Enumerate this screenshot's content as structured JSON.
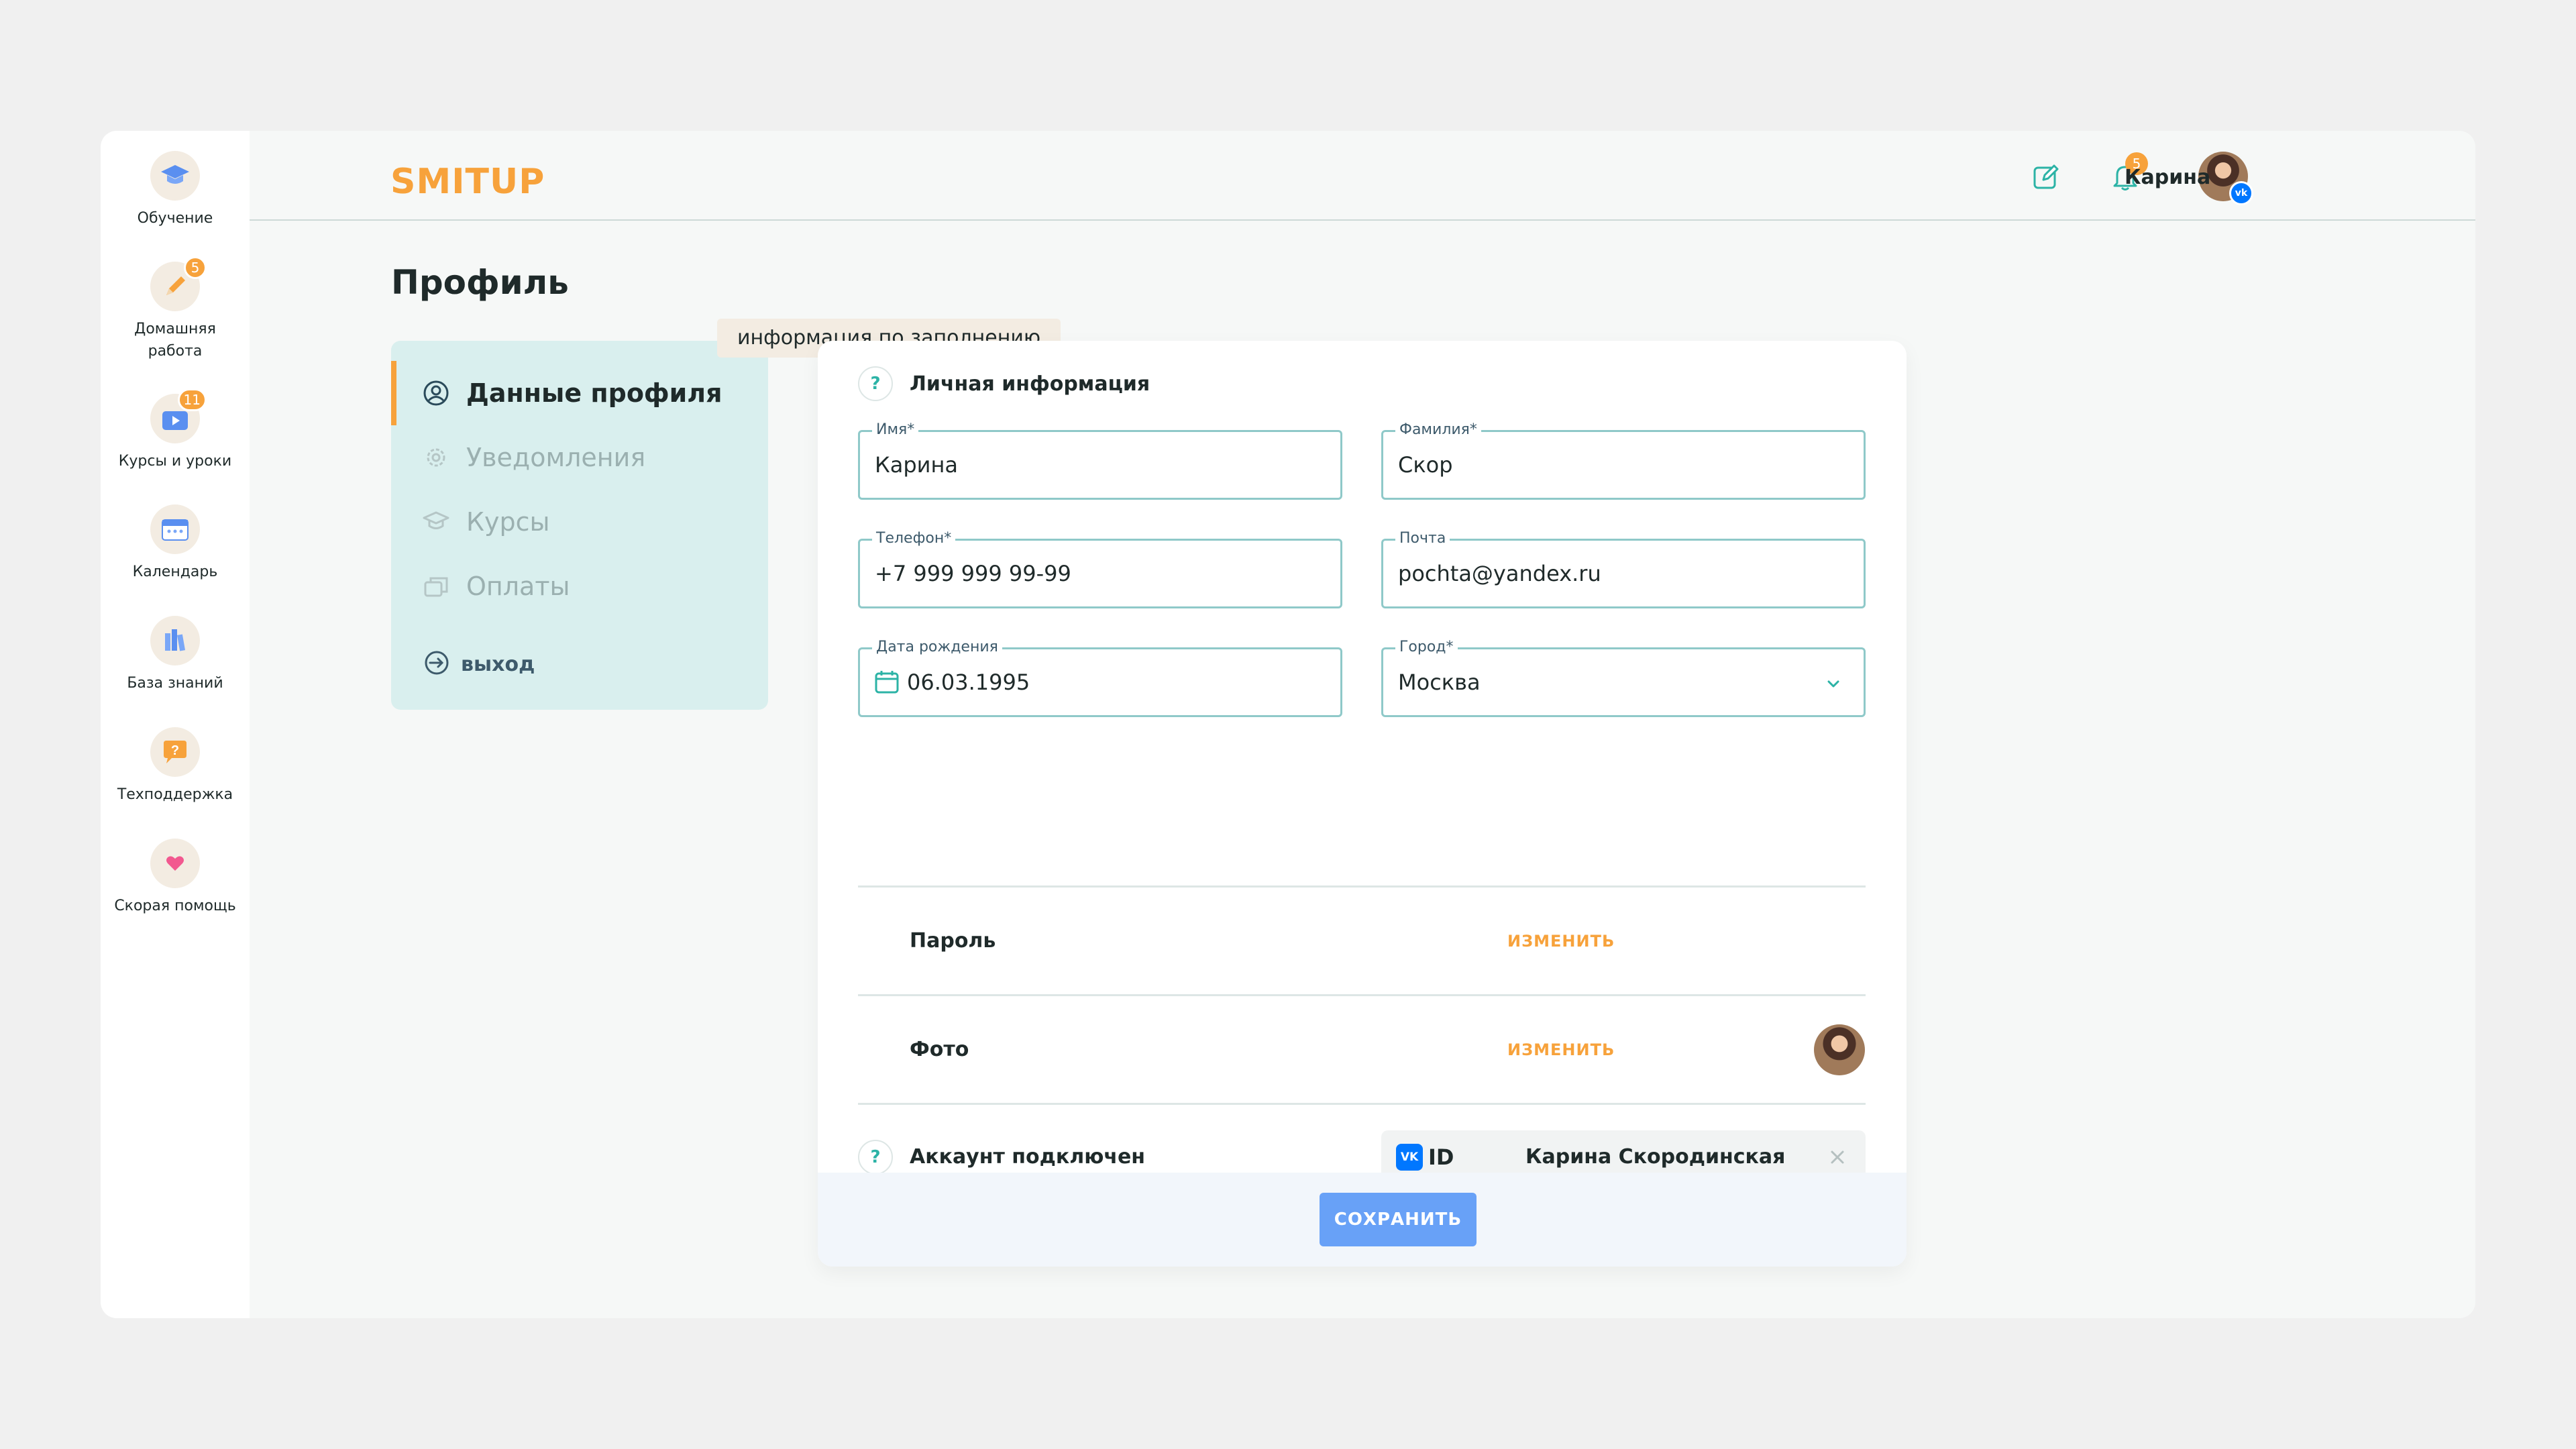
{
  "sidebar": {
    "items": [
      {
        "label": "Обучение",
        "icon": "graduation-cap-icon"
      },
      {
        "label": "Домашняя\nработа",
        "icon": "pencil-icon",
        "badge": "5"
      },
      {
        "label": "Курсы и уроки",
        "icon": "video-lessons-icon",
        "badge": "11"
      },
      {
        "label": "Календарь",
        "icon": "calendar-icon"
      },
      {
        "label": "База знаний",
        "icon": "books-icon"
      },
      {
        "label": "Техподдержка",
        "icon": "support-chat-icon"
      },
      {
        "label": "Скорая помощь",
        "icon": "heart-icon"
      }
    ]
  },
  "header": {
    "logo": "SMITUP",
    "notifications_badge": "5",
    "user_name": "Карина"
  },
  "page": {
    "title": "Профиль"
  },
  "profile_menu": {
    "items": [
      {
        "label": "Данные профиля",
        "active": true
      },
      {
        "label": "Уведомления",
        "active": false
      },
      {
        "label": "Курсы",
        "active": false
      },
      {
        "label": "Оплаты",
        "active": false
      }
    ],
    "logout": "выход"
  },
  "tooltip": "информация по заполнению",
  "personal": {
    "title": "Личная информация",
    "fields": {
      "first_name": {
        "label": "Имя*",
        "value": "Карина"
      },
      "last_name": {
        "label": "Фамилия*",
        "value": "Скор"
      },
      "phone": {
        "label": "Телефон*",
        "value": "+7 999 999 99-99"
      },
      "email": {
        "label": "Почта",
        "value": "pochta@yandex.ru"
      },
      "birthdate": {
        "label": "Дата рождения",
        "value": "06.03.1995"
      },
      "city": {
        "label": "Город*",
        "value": "Москва"
      }
    }
  },
  "password": {
    "label": "Пароль",
    "action": "ИЗМЕНИТЬ"
  },
  "photo": {
    "label": "Фото",
    "action": "ИЗМЕНИТЬ"
  },
  "account": {
    "label": "Аккаунт подключен",
    "provider": "ID",
    "provider_logo": "VK",
    "name": "Карина Скородинская"
  },
  "save_label": "СОХРАНИТЬ",
  "colors": {
    "accent": "#f7a23b",
    "primary_button": "#68a1f7",
    "menu_bg": "#d9efee",
    "teal": "#2cb3a6"
  }
}
